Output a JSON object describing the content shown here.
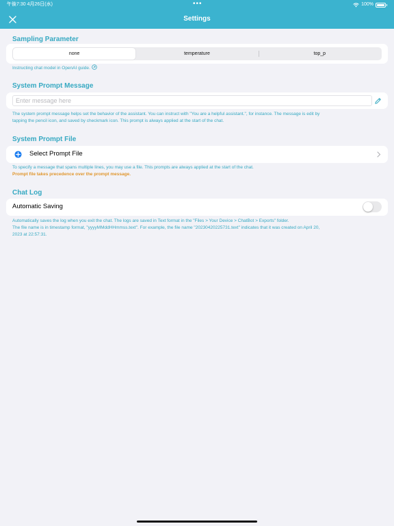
{
  "status_bar": {
    "time_date": "午後7:30  4月26日(水)",
    "multitask_dots": "•••",
    "battery": "100%"
  },
  "nav": {
    "title": "Settings",
    "close_icon": "close-icon"
  },
  "sampling": {
    "title": "Sampling Parameter",
    "options": [
      "none",
      "temperature",
      "top_p"
    ],
    "selected": "none",
    "note": "Instructing chat model in OpenAI guide."
  },
  "system_prompt": {
    "title": "System Prompt Message",
    "placeholder": "Enter message here",
    "value": "",
    "note_line1": "The system prompt message helps set the behavior of the assistant. You can instruct with \"You are a helpful assistant.\", for instance. The message is edit by",
    "note_line2": "tapping the pencil icon, and saved by checkmark icon. This prompt is always applied at the start of the chat."
  },
  "prompt_file": {
    "title": "System Prompt File",
    "row_label": "Select Prompt File",
    "note": "To specify a message that spans multiple lines, you may use a file. This prompts are always applied at the start of the chat.",
    "warning": "Prompt file takes precedence over the prompt message."
  },
  "chat_log": {
    "title": "Chat Log",
    "row_label": "Automatic Saving",
    "auto_save_enabled": false,
    "note_line1": "Automatically saves the log when you exit the chat. The logs are saved in Text format in the \"Files > Your Device > ChatBot > Exports\" folder.",
    "note_line2": "The file name is in timestamp format, \"yyyyMMddHHmmss.text\". For example, the file name \"20230420225731.text\" indicates that it was created on April 20,",
    "note_line3": "2023 at 22:57:31."
  },
  "colors": {
    "accent": "#3bb3cf",
    "section": "#36a9c2",
    "warning": "#e0962d",
    "add": "#1a7cf0"
  }
}
